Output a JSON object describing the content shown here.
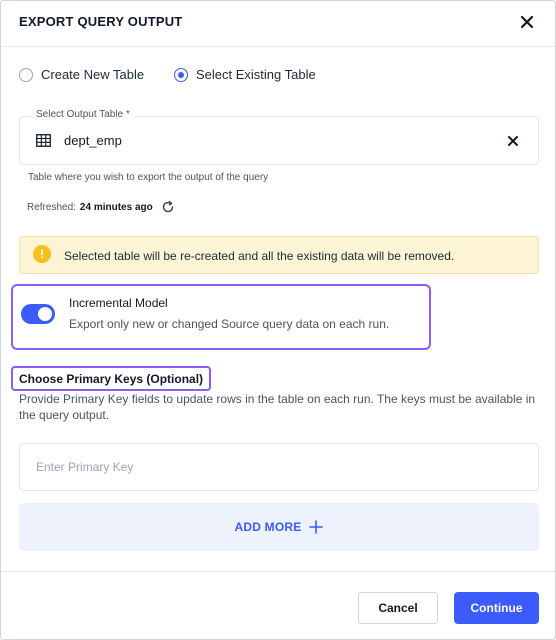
{
  "dialog": {
    "title": "EXPORT QUERY OUTPUT"
  },
  "radio_options": [
    {
      "label": "Create New Table",
      "selected": false
    },
    {
      "label": "Select Existing Table",
      "selected": true
    }
  ],
  "output_table": {
    "label": "Select Output Table *",
    "value": "dept_emp",
    "helper": "Table where you wish to export the output of the query",
    "refreshed_label": "Refreshed:",
    "refreshed_value": "24 minutes ago"
  },
  "warning": {
    "icon": "!",
    "text": "Selected table will be re-created and all the existing data will be removed."
  },
  "incremental": {
    "enabled": true,
    "title": "Incremental Model",
    "description": "Export only new or changed Source query data on each run."
  },
  "primary_keys": {
    "heading": "Choose Primary Keys (Optional)",
    "description": "Provide Primary Key fields to update rows in the table on each run. The keys must be available in the query output.",
    "input_placeholder": "Enter Primary Key",
    "input_value": "",
    "add_more_label": "ADD MORE"
  },
  "footer": {
    "cancel_label": "Cancel",
    "continue_label": "Continue"
  },
  "colors": {
    "accent": "#3b5bfd",
    "highlight_outline": "#8b5cf6",
    "warning_bg": "#fdf3d5",
    "warning_icon": "#f4c21b"
  }
}
